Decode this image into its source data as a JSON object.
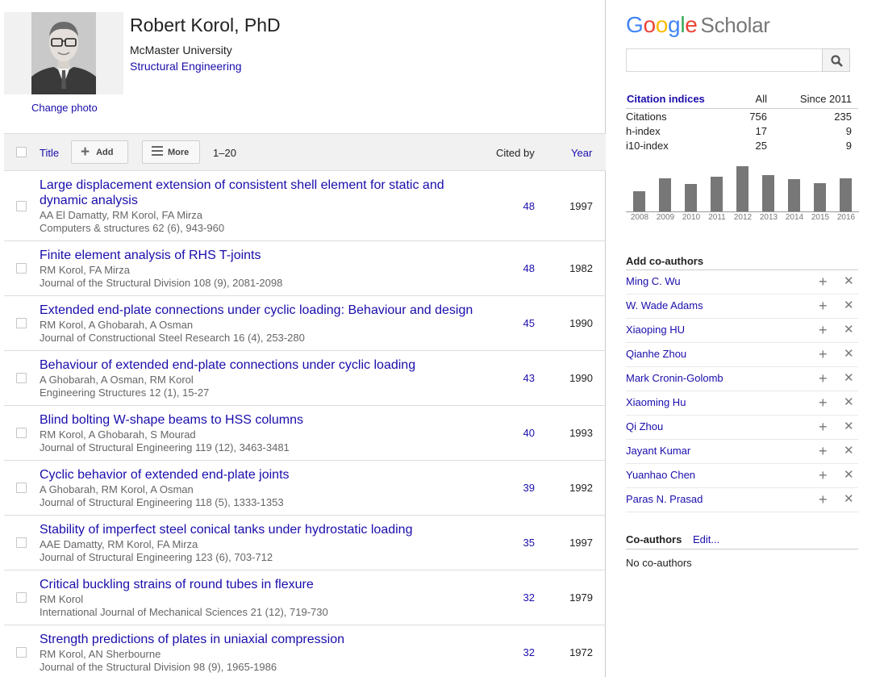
{
  "profile": {
    "name": "Robert Korol, PhD",
    "affiliation": "McMaster University",
    "interest": "Structural Engineering",
    "change_photo": "Change photo"
  },
  "toolbar": {
    "title": "Title",
    "add": "Add",
    "more": "More",
    "range": "1–20",
    "cited_by": "Cited by",
    "year": "Year"
  },
  "publications": [
    {
      "title": "Large displacement extension of consistent shell element for static and dynamic analysis",
      "authors": "AA El Damatty, RM Korol, FA Mirza",
      "venue": "Computers & structures 62 (6), 943-960",
      "cited": "48",
      "year": "1997"
    },
    {
      "title": "Finite element analysis of RHS T-joints",
      "authors": "RM Korol, FA Mirza",
      "venue": "Journal of the Structural Division 108 (9), 2081-2098",
      "cited": "48",
      "year": "1982"
    },
    {
      "title": "Extended end-plate connections under cyclic loading: Behaviour and design",
      "authors": "RM Korol, A Ghobarah, A Osman",
      "venue": "Journal of Constructional Steel Research 16 (4), 253-280",
      "cited": "45",
      "year": "1990"
    },
    {
      "title": "Behaviour of extended end-plate connections under cyclic loading",
      "authors": "A Ghobarah, A Osman, RM Korol",
      "venue": "Engineering Structures 12 (1), 15-27",
      "cited": "43",
      "year": "1990"
    },
    {
      "title": "Blind bolting W-shape beams to HSS columns",
      "authors": "RM Korol, A Ghobarah, S Mourad",
      "venue": "Journal of Structural Engineering 119 (12), 3463-3481",
      "cited": "40",
      "year": "1993"
    },
    {
      "title": "Cyclic behavior of extended end-plate joints",
      "authors": "A Ghobarah, RM Korol, A Osman",
      "venue": "Journal of Structural Engineering 118 (5), 1333-1353",
      "cited": "39",
      "year": "1992"
    },
    {
      "title": "Stability of imperfect steel conical tanks under hydrostatic loading",
      "authors": "AAE Damatty, RM Korol, FA Mirza",
      "venue": "Journal of Structural Engineering 123 (6), 703-712",
      "cited": "35",
      "year": "1997"
    },
    {
      "title": "Critical buckling strains of round tubes in flexure",
      "authors": "RM Korol",
      "venue": "International Journal of Mechanical Sciences 21 (12), 719-730",
      "cited": "32",
      "year": "1979"
    },
    {
      "title": "Strength predictions of plates in uniaxial compression",
      "authors": "RM Korol, AN Sherbourne",
      "venue": "Journal of the Structural Division 98 (9), 1965-1986",
      "cited": "32",
      "year": "1972"
    }
  ],
  "brand": {
    "google": "Google",
    "scholar": "Scholar",
    "colors": {
      "blue": "#4285f4",
      "red": "#ea4335",
      "yellow": "#fbbc05",
      "green": "#34a853",
      "link": "#1a0dab"
    }
  },
  "search": {
    "placeholder": "",
    "icon": "search-icon"
  },
  "citation_indices": {
    "header": "Citation indices",
    "col_all": "All",
    "col_since": "Since 2011",
    "rows": [
      {
        "label": "Citations",
        "all": "756",
        "since": "235"
      },
      {
        "label": "h-index",
        "all": "17",
        "since": "9"
      },
      {
        "label": "i10-index",
        "all": "25",
        "since": "9"
      }
    ]
  },
  "citations_per_year": {
    "years": [
      "2008",
      "2009",
      "2010",
      "2011",
      "2012",
      "2013",
      "2014",
      "2015",
      "2016"
    ],
    "values": [
      25,
      41,
      34,
      43,
      56,
      45,
      40,
      35,
      41
    ]
  },
  "add_coauthors": {
    "title": "Add co-authors",
    "plus": "+",
    "close": "✕",
    "people": [
      "Ming C. Wu",
      "W. Wade Adams",
      "Xiaoping HU",
      "Qianhe Zhou",
      "Mark Cronin-Golomb",
      "Xiaoming Hu",
      "Qi Zhou",
      "Jayant Kumar",
      "Yuanhao Chen",
      "Paras N. Prasad"
    ]
  },
  "coauthors": {
    "title": "Co-authors",
    "edit": "Edit...",
    "empty": "No co-authors"
  }
}
